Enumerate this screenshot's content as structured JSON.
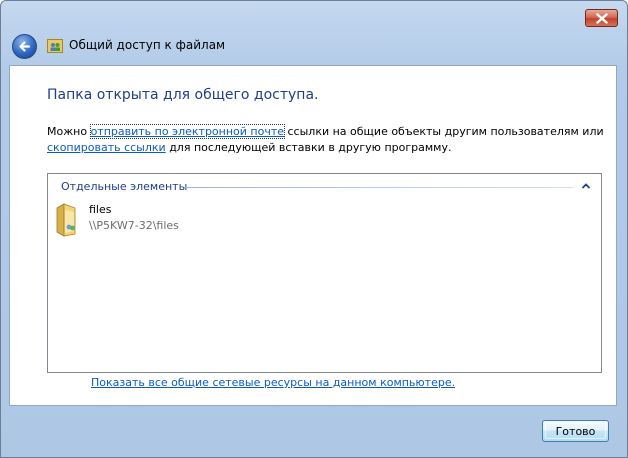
{
  "window": {
    "title": "Общий доступ к файлам"
  },
  "content": {
    "heading": "Папка открыта для общего доступа.",
    "desc_prefix": "Можно ",
    "desc_link_email": "отправить по электронной почте",
    "desc_middle": " ссылки на общие объекты другим пользователям или ",
    "desc_link_copy": "скопировать ссылки",
    "desc_suffix": " для последующей вставки в другую программу.",
    "list": {
      "group_header": "Отдельные элементы",
      "items": [
        {
          "name": "files",
          "path": "\\\\P5KW7-32\\files"
        }
      ]
    },
    "show_all_link": "Показать все общие сетевые ресурсы на данном компьютере."
  },
  "footer": {
    "done_label": "Готово"
  },
  "colors": {
    "heading": "#1e3f8a",
    "link": "#0b5bc4",
    "close_button": "#c4432d"
  },
  "icons": {
    "back": "back-arrow-icon",
    "title": "share-people-icon",
    "file": "folder-icon",
    "close": "close-icon",
    "collapse": "chevron-up-icon"
  }
}
